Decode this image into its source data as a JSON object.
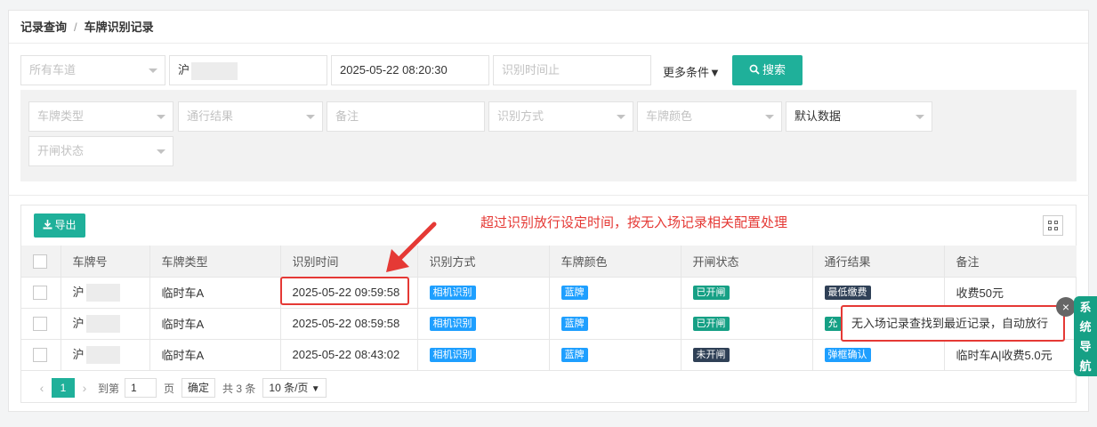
{
  "breadcrumb": {
    "root": "记录查询",
    "separator": "/",
    "current": "车牌识别记录"
  },
  "filters": {
    "lane_placeholder": "所有车道",
    "plate_value": "沪",
    "time_start": "2025-05-22 08:20:30",
    "time_end_placeholder": "识别时间止",
    "more_label": "更多条件▼",
    "search_label": "搜索"
  },
  "advanced": {
    "plate_type_placeholder": "车牌类型",
    "pass_result_placeholder": "通行结果",
    "remark_placeholder": "备注",
    "recognize_method_placeholder": "识别方式",
    "plate_color_placeholder": "车牌颜色",
    "data_source_value": "默认数据",
    "gate_status_placeholder": "开闸状态"
  },
  "toolbar": {
    "export_label": "导出"
  },
  "annotation": {
    "text": "超过识别放行设定时间，按无入场记录相关配置处理"
  },
  "table": {
    "headers": [
      "车牌号",
      "车牌类型",
      "识别时间",
      "识别方式",
      "车牌颜色",
      "开闸状态",
      "通行结果",
      "备注"
    ],
    "rows": [
      {
        "plate": "沪",
        "type": "临时车A",
        "time": "2025-05-22 09:59:58",
        "method": "相机识别",
        "color": "蓝牌",
        "gate": "已开闸",
        "result": "最低缴费",
        "remark": "收费50元"
      },
      {
        "plate": "沪",
        "type": "临时车A",
        "time": "2025-05-22 08:59:58",
        "method": "相机识别",
        "color": "蓝牌",
        "gate": "已开闸",
        "result": "允",
        "remark": ""
      },
      {
        "plate": "沪",
        "type": "临时车A",
        "time": "2025-05-22 08:43:02",
        "method": "相机识别",
        "color": "蓝牌",
        "gate": "未开闸",
        "result": "弹框确认",
        "remark": "临时车A|收费5.0元"
      }
    ]
  },
  "pager": {
    "current_page": "1",
    "goto_label": "到第",
    "goto_value": "1",
    "page_unit": "页",
    "confirm_label": "确定",
    "total_label": "共 3 条",
    "page_size": "10 条/页"
  },
  "tooltip": {
    "text": "无入场记录查找到最近记录，自动放行"
  },
  "side_nav": {
    "label": "系统导航"
  }
}
